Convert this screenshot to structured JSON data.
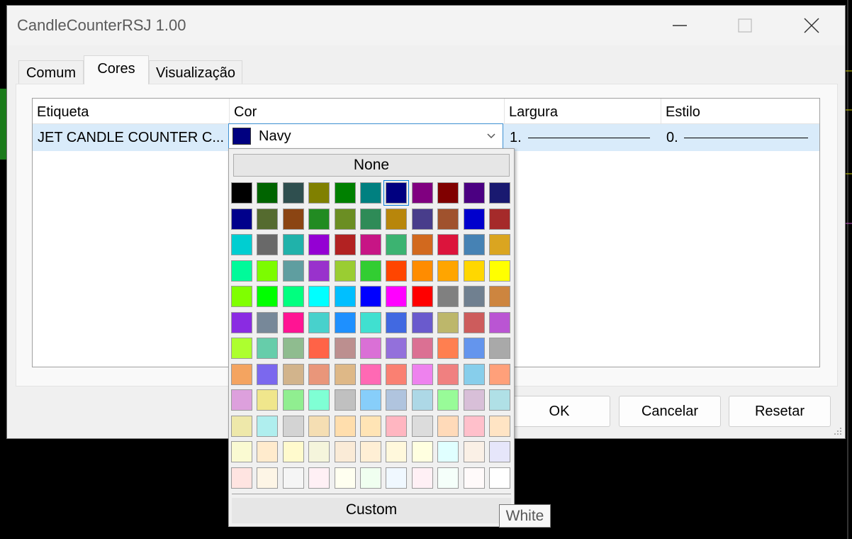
{
  "window": {
    "title": "CandleCounterRSJ 1.00"
  },
  "tabs": [
    {
      "label": "Comum",
      "active": false
    },
    {
      "label": "Cores",
      "active": true
    },
    {
      "label": "Visualização",
      "active": false
    }
  ],
  "table": {
    "headers": [
      "Etiqueta",
      "Cor",
      "Largura",
      "Estilo"
    ],
    "row": {
      "label": "JET CANDLE COUNTER C...",
      "color_name": "Navy",
      "color_hex": "#000080",
      "width": "1.",
      "style": "0."
    }
  },
  "buttons": {
    "ok": "OK",
    "cancel": "Cancelar",
    "reset": "Resetar"
  },
  "color_picker": {
    "none_label": "None",
    "custom_label": "Custom",
    "selected": "#000080",
    "hover_tooltip": "White",
    "colors": [
      [
        "#000000",
        "#006400",
        "#2F4F4F",
        "#808000",
        "#008000",
        "#008080",
        "#000080",
        "#800080",
        "#800000",
        "#4B0082",
        "#191970"
      ],
      [
        "#00008B",
        "#556B2F",
        "#8B4513",
        "#228B22",
        "#6B8E23",
        "#2E8B57",
        "#B8860B",
        "#483D8B",
        "#A0522D",
        "#0000CD",
        "#A52A2A"
      ],
      [
        "#00CED1",
        "#696969",
        "#20B2AA",
        "#9400D3",
        "#B22222",
        "#C71585",
        "#3CB371",
        "#D2691E",
        "#DC143C",
        "#4682B4",
        "#DAA520"
      ],
      [
        "#00FA9A",
        "#7CFC00",
        "#5F9EA0",
        "#9932CC",
        "#9ACD32",
        "#32CD32",
        "#FF4500",
        "#FF8C00",
        "#FFA500",
        "#FFD700",
        "#FFFF00"
      ],
      [
        "#7FFF00",
        "#00FF00",
        "#00FF7F",
        "#00FFFF",
        "#00BFFF",
        "#0000FF",
        "#FF00FF",
        "#FF0000",
        "#808080",
        "#708090",
        "#CD853F"
      ],
      [
        "#8A2BE2",
        "#778899",
        "#FF1493",
        "#48D1CC",
        "#1E90FF",
        "#40E0D0",
        "#4169E1",
        "#6A5ACD",
        "#BDB76B",
        "#CD5C5C",
        "#BA55D3"
      ],
      [
        "#ADFF2F",
        "#66CDAA",
        "#8FBC8F",
        "#FF6347",
        "#BC8F8F",
        "#DA70D6",
        "#9370DB",
        "#DB7093",
        "#FF7F50",
        "#6495ED",
        "#A9A9A9"
      ],
      [
        "#F4A460",
        "#7B68EE",
        "#D2B48C",
        "#E9967A",
        "#DEB887",
        "#FF69B4",
        "#FA8072",
        "#EE82EE",
        "#F08080",
        "#87CEEB",
        "#FFA07A"
      ],
      [
        "#DDA0DD",
        "#F0E68C",
        "#90EE90",
        "#7FFFD4",
        "#C0C0C0",
        "#87CEFA",
        "#B0C4DE",
        "#ADD8E6",
        "#98FB98",
        "#D8BFD8",
        "#B0E0E6"
      ],
      [
        "#EEE8AA",
        "#AFEEEE",
        "#D3D3D3",
        "#F5DEB3",
        "#FFDEAD",
        "#FFE4B5",
        "#FFB6C1",
        "#DCDCDC",
        "#FFDAB9",
        "#FFC0CB",
        "#FFE4C4"
      ],
      [
        "#FAFAD2",
        "#FFEBCD",
        "#FFFACD",
        "#F5F5DC",
        "#FAEBD7",
        "#FFEFD5",
        "#FFF8DC",
        "#FFFFE0",
        "#E0FFFF",
        "#FAF0E6",
        "#E6E6FA"
      ],
      [
        "#FFE4E1",
        "#FDF5E6",
        "#F5F5F5",
        "#FFF0F5",
        "#FFFFF0",
        "#F0FFF0",
        "#F0F8FF",
        "#FFF0F5",
        "#F5FFFA",
        "#FFFAFA",
        "#FFFFFF"
      ]
    ]
  }
}
